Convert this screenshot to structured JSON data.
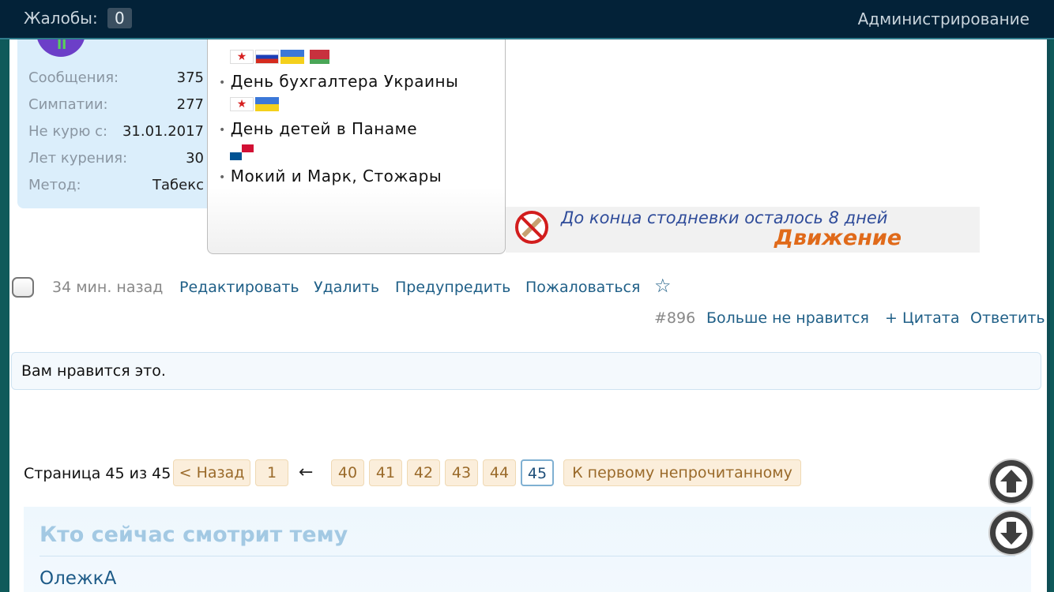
{
  "topbar": {
    "complaints_label": "Жалобы:",
    "complaints_count": "0",
    "admin_label": "Администрирование"
  },
  "user_stats": [
    {
      "label": "Сообщения:",
      "value": "375"
    },
    {
      "label": "Симпатии:",
      "value": "277"
    },
    {
      "label": "Не курю с:",
      "value": "31.01.2017"
    },
    {
      "label": "Лет курения:",
      "value": "30"
    },
    {
      "label": "Метод:",
      "value": "Табекс"
    }
  ],
  "calendar": {
    "events": [
      "День бухгалтера Украины",
      "День детей в Панаме",
      "Мокий и Марк, Стожары"
    ]
  },
  "banner": {
    "line1": "До конца стодневки осталось 8 дней",
    "line2": "Движение"
  },
  "post_actions": {
    "time": "34 мин. назад",
    "edit": "Редактировать",
    "delete": "Удалить",
    "warn": "Предупредить",
    "report": "Пожаловаться",
    "star": "☆",
    "post_number": "#896",
    "unlike": "Больше не нравится",
    "quote": "+ Цитата",
    "reply": "Ответить"
  },
  "likes_text": "Вам нравится это.",
  "pagination": {
    "label": "Страница 45 из 45",
    "prev": "< Назад",
    "first": "1",
    "arrow": "←",
    "pages": [
      "40",
      "41",
      "42",
      "43",
      "44",
      "45"
    ],
    "current": "45",
    "unread": "К первому непрочитанному"
  },
  "watching": {
    "title": "Кто сейчас смотрит тему",
    "user": "ОлежкА"
  },
  "icons": {
    "scroll_up": "arrow-up-icon",
    "scroll_down": "arrow-down-icon"
  }
}
